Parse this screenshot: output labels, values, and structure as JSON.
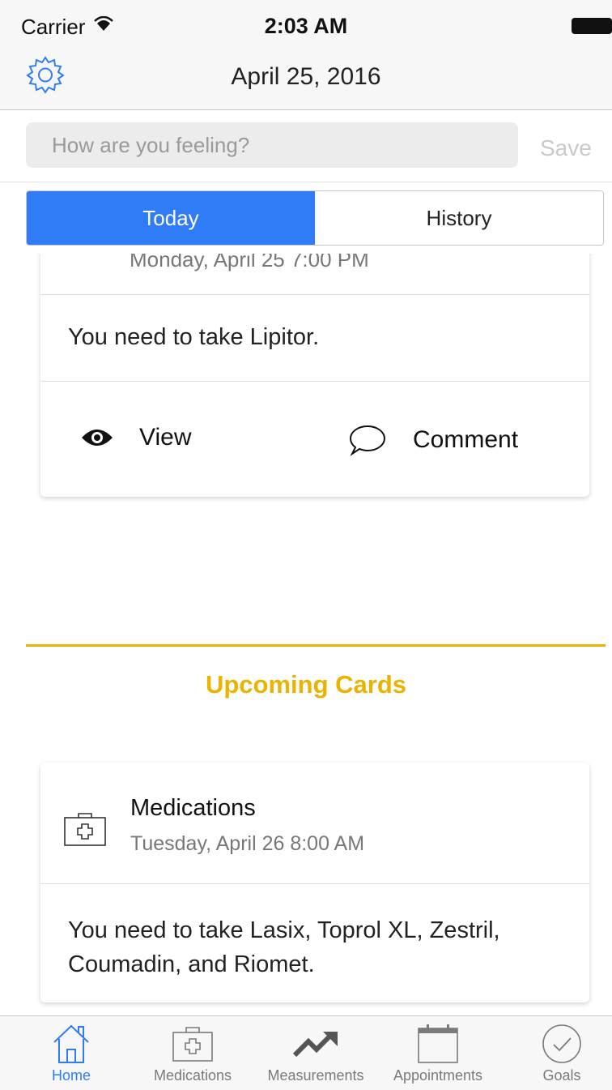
{
  "status": {
    "carrier": "Carrier",
    "time": "2:03 AM"
  },
  "nav": {
    "title": "April 25, 2016",
    "settings_icon": "gear-icon"
  },
  "feeling": {
    "placeholder": "How are you feeling?",
    "save_label": "Save"
  },
  "segments": {
    "today": "Today",
    "history": "History"
  },
  "cards": {
    "first": {
      "clipped_time": "Monday, April 25 7:00 PM",
      "message": "You need to take Lipitor.",
      "view_label": "View",
      "comment_label": "Comment"
    },
    "upcoming_title": "Upcoming Cards",
    "second": {
      "icon": "medical-kit-icon",
      "title": "Medications",
      "time": "Tuesday, April 26 8:00 AM",
      "message": "You need to take Lasix, Toprol XL, Zestril, Coumadin, and Riomet."
    }
  },
  "tabs": [
    {
      "label": "Home",
      "icon": "home-icon",
      "active": true
    },
    {
      "label": "Medications",
      "icon": "medical-kit-icon",
      "active": false
    },
    {
      "label": "Measurements",
      "icon": "trend-up-icon",
      "active": false
    },
    {
      "label": "Appointments",
      "icon": "calendar-icon",
      "active": false
    },
    {
      "label": "Goals",
      "icon": "check-circle-icon",
      "active": false
    }
  ],
  "colors": {
    "accent_blue": "#2f7cf6",
    "section_gold": "#e9b300"
  }
}
